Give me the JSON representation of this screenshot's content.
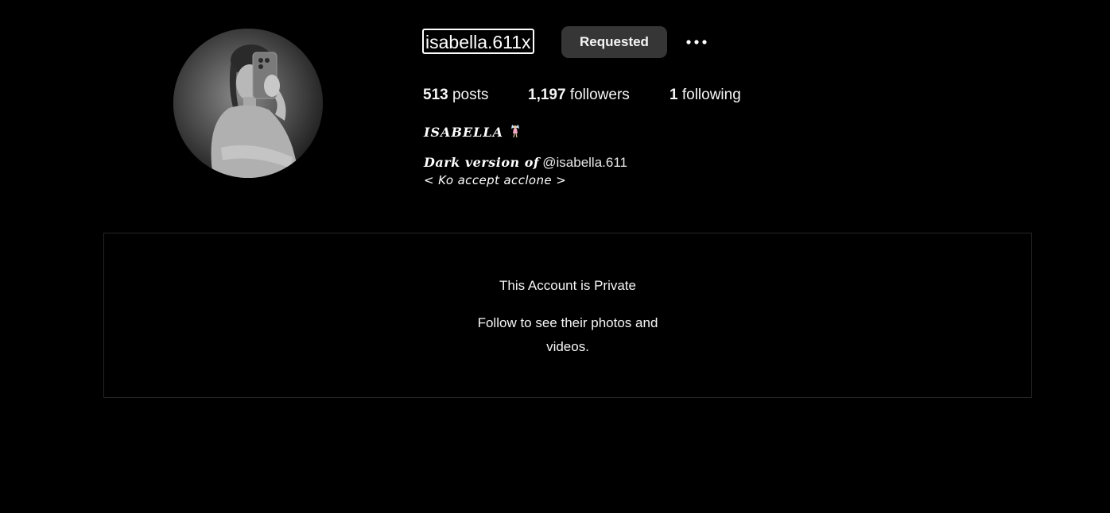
{
  "profile": {
    "username": "isabella.611x",
    "avatar_icon": "profile-photo",
    "requested_label": "Requested",
    "more_icon": "more-horizontal-icon"
  },
  "stats": {
    "posts_count": "513",
    "posts_label": "posts",
    "followers_count": "1,197",
    "followers_label": "followers",
    "following_count": "1",
    "following_label": "following"
  },
  "bio": {
    "full_name": "ISABELLA",
    "name_icon": "fairy-icon",
    "line1_text": "Dark version of",
    "line1_mention": "@isabella.611",
    "line2_text": "< Ko accept acclone >"
  },
  "private_notice": {
    "title": "This Account is Private",
    "subtitle": "Follow to see their photos and videos."
  },
  "colors": {
    "background": "#000000",
    "text": "#f5f5f5",
    "button_bg": "#363636",
    "border": "#262626"
  }
}
